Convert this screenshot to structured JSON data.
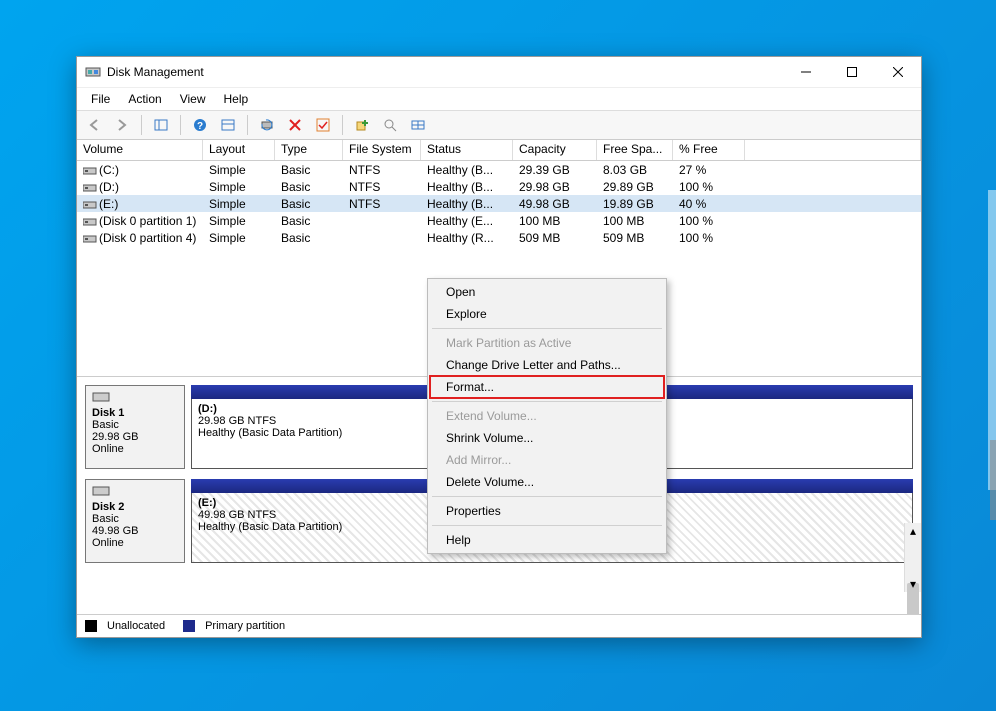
{
  "app": {
    "title": "Disk Management"
  },
  "menubar": [
    "File",
    "Action",
    "View",
    "Help"
  ],
  "columns": [
    "Volume",
    "Layout",
    "Type",
    "File System",
    "Status",
    "Capacity",
    "Free Spa...",
    "% Free"
  ],
  "volumes": [
    {
      "name": "(C:)",
      "layout": "Simple",
      "type": "Basic",
      "fs": "NTFS",
      "status": "Healthy (B...",
      "cap": "29.39 GB",
      "free": "8.03 GB",
      "pct": "27 %",
      "selected": false
    },
    {
      "name": "(D:)",
      "layout": "Simple",
      "type": "Basic",
      "fs": "NTFS",
      "status": "Healthy (B...",
      "cap": "29.98 GB",
      "free": "29.89 GB",
      "pct": "100 %",
      "selected": false
    },
    {
      "name": "(E:)",
      "layout": "Simple",
      "type": "Basic",
      "fs": "NTFS",
      "status": "Healthy (B...",
      "cap": "49.98 GB",
      "free": "19.89 GB",
      "pct": "40 %",
      "selected": true
    },
    {
      "name": "(Disk 0 partition 1)",
      "layout": "Simple",
      "type": "Basic",
      "fs": "",
      "status": "Healthy (E...",
      "cap": "100 MB",
      "free": "100 MB",
      "pct": "100 %",
      "selected": false
    },
    {
      "name": "(Disk 0 partition 4)",
      "layout": "Simple",
      "type": "Basic",
      "fs": "",
      "status": "Healthy (R...",
      "cap": "509 MB",
      "free": "509 MB",
      "pct": "100 %",
      "selected": false
    }
  ],
  "disk1": {
    "title": "Disk 1",
    "type": "Basic",
    "size": "29.98 GB",
    "state": "Online",
    "vol_label": "(D:)",
    "vol_size": "29.98 GB NTFS",
    "vol_status": "Healthy (Basic Data Partition)"
  },
  "disk2": {
    "title": "Disk 2",
    "type": "Basic",
    "size": "49.98 GB",
    "state": "Online",
    "vol_label": "(E:)",
    "vol_size": "49.98 GB NTFS",
    "vol_status": "Healthy (Basic Data Partition)"
  },
  "legend": {
    "unalloc": "Unallocated",
    "primary": "Primary partition"
  },
  "context_menu": [
    {
      "label": "Open",
      "disabled": false,
      "hl": false
    },
    {
      "label": "Explore",
      "disabled": false,
      "hl": false
    },
    {
      "sep": true
    },
    {
      "label": "Mark Partition as Active",
      "disabled": true,
      "hl": false
    },
    {
      "label": "Change Drive Letter and Paths...",
      "disabled": false,
      "hl": false
    },
    {
      "label": "Format...",
      "disabled": false,
      "hl": true
    },
    {
      "sep": true
    },
    {
      "label": "Extend Volume...",
      "disabled": true,
      "hl": false
    },
    {
      "label": "Shrink Volume...",
      "disabled": false,
      "hl": false
    },
    {
      "label": "Add Mirror...",
      "disabled": true,
      "hl": false
    },
    {
      "label": "Delete Volume...",
      "disabled": false,
      "hl": false
    },
    {
      "sep": true
    },
    {
      "label": "Properties",
      "disabled": false,
      "hl": false
    },
    {
      "sep": true
    },
    {
      "label": "Help",
      "disabled": false,
      "hl": false
    }
  ]
}
